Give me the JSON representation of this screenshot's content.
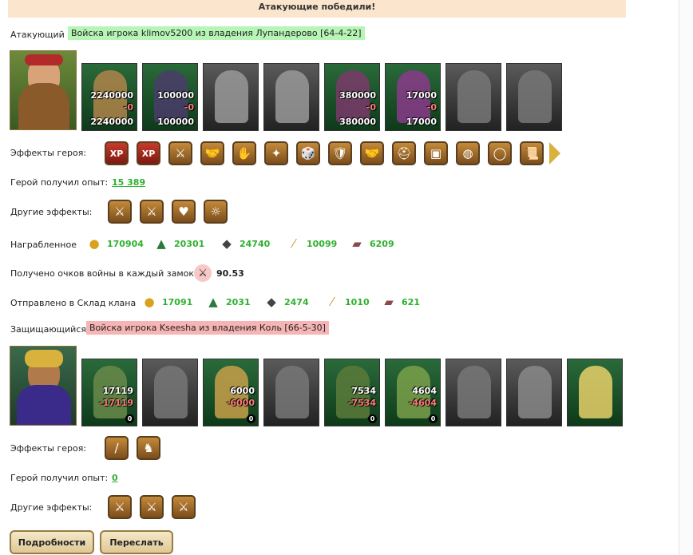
{
  "banner": "Атакующие победили!",
  "attacker": {
    "label": "Атакующий",
    "army": "Войска игрока klimov5200 из владения Лупандерово [64-4-22]",
    "units": [
      {
        "top": "2240000",
        "mid": "-0",
        "bot": "2240000"
      },
      {
        "top": "100000",
        "mid": "-0",
        "bot": "100000"
      },
      {},
      {},
      {
        "top": "380000",
        "mid": "-0",
        "bot": "380000"
      },
      {
        "top": "17000",
        "mid": "-0",
        "bot": "17000"
      },
      {},
      {}
    ],
    "hero_effects_label": "Эффекты героя:",
    "hero_effects": [
      "XP",
      "XP",
      "⚔",
      "🤝",
      "✋",
      "✦",
      "🎲",
      "🛡",
      "🤝",
      "⛑",
      "▣",
      "◍",
      "◯",
      "📜"
    ],
    "exp_label": "Герой получил опыт:",
    "exp_value": "15 389",
    "other_effects_label": "Другие эффекты:",
    "other_effects": [
      "⚔",
      "⚔",
      "♥",
      "☼"
    ],
    "loot_label": "Награбленное",
    "loot": [
      {
        "icon": "gold-icon",
        "value": "170904"
      },
      {
        "icon": "wood-icon",
        "value": "20301"
      },
      {
        "icon": "ore-icon",
        "value": "24740"
      },
      {
        "icon": "grain-icon",
        "value": "10099"
      },
      {
        "icon": "stone-icon",
        "value": "6209"
      }
    ],
    "war_points_label": "Получено очков войны в каждый замок",
    "war_points_value": "90.53",
    "clan_label": "Отправлено в Склад клана",
    "clan": [
      {
        "icon": "gold-icon",
        "value": "17091"
      },
      {
        "icon": "wood-icon",
        "value": "2031"
      },
      {
        "icon": "ore-icon",
        "value": "2474"
      },
      {
        "icon": "grain-icon",
        "value": "1010"
      },
      {
        "icon": "stone-icon",
        "value": "621"
      }
    ]
  },
  "defender": {
    "label": "Защищающийся",
    "army": "Войска игрока Kseesha из владения Коль [66-5-30]",
    "units": [
      {
        "top": "17119",
        "mid": "-17119",
        "zero": "0"
      },
      {},
      {
        "top": "6000",
        "mid": "-6000",
        "zero": "0"
      },
      {},
      {
        "top": "7534",
        "mid": "-7534",
        "zero": "0"
      },
      {
        "top": "4604",
        "mid": "-4604",
        "zero": "0"
      },
      {},
      {},
      {}
    ],
    "hero_effects_label": "Эффекты героя:",
    "hero_effects": [
      "/",
      "♞"
    ],
    "exp_label": "Герой получил опыт:",
    "exp_value": "0",
    "other_effects_label": "Другие эффекты:",
    "other_effects": [
      "⚔",
      "⚔",
      "⚔"
    ]
  },
  "buttons": {
    "details": "Подробности",
    "forward": "Переслать"
  }
}
